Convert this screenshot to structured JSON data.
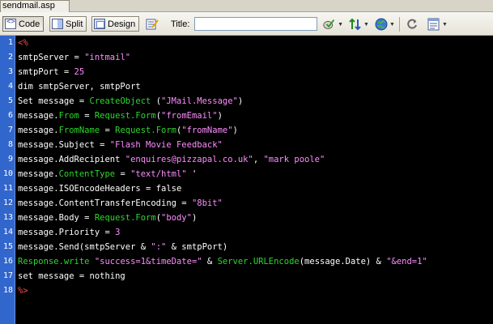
{
  "tab": {
    "label": "sendmail.asp"
  },
  "toolbar": {
    "code_label": "Code",
    "split_label": "Split",
    "design_label": "Design",
    "title_label": "Title:",
    "title_value": "",
    "icons": [
      "live-data-icon",
      "file-management-icon",
      "preview-globe-icon",
      "refresh-icon",
      "view-options-icon",
      "validate-icon"
    ]
  },
  "colors": {
    "background": "#000000",
    "gutter": "#3166cc",
    "plain": "#ffffff",
    "string": "#ff8cff",
    "member": "#2bd92b",
    "delimiter": "#ff4a4a"
  },
  "code_lines": [
    {
      "n": "1",
      "tokens": [
        [
          "delim",
          "<%"
        ]
      ]
    },
    {
      "n": "2",
      "tokens": [
        [
          "plain",
          "smtpServer = "
        ],
        [
          "string",
          "\"intmail\""
        ]
      ]
    },
    {
      "n": "3",
      "tokens": [
        [
          "plain",
          "smtpPort = "
        ],
        [
          "number",
          "25"
        ]
      ]
    },
    {
      "n": "4",
      "tokens": [
        [
          "plain",
          "dim smtpServer, smtpPort"
        ]
      ]
    },
    {
      "n": "5",
      "tokens": [
        [
          "plain",
          "Set message = "
        ],
        [
          "member",
          "CreateObject"
        ],
        [
          "plain",
          " ("
        ],
        [
          "string",
          "\"JMail.Message\""
        ],
        [
          "plain",
          ")"
        ]
      ]
    },
    {
      "n": "6",
      "tokens": [
        [
          "plain",
          "message."
        ],
        [
          "member",
          "From"
        ],
        [
          "plain",
          " = "
        ],
        [
          "member",
          "Request.Form"
        ],
        [
          "plain",
          "("
        ],
        [
          "string",
          "\"fromEmail\""
        ],
        [
          "plain",
          ")"
        ]
      ]
    },
    {
      "n": "7",
      "tokens": [
        [
          "plain",
          "message."
        ],
        [
          "member",
          "FromName"
        ],
        [
          "plain",
          " = "
        ],
        [
          "member",
          "Request.Form"
        ],
        [
          "plain",
          "("
        ],
        [
          "string",
          "\"fromName\""
        ],
        [
          "plain",
          ")"
        ]
      ]
    },
    {
      "n": "8",
      "tokens": [
        [
          "plain",
          "message.Subject = "
        ],
        [
          "string",
          "\"Flash Movie Feedback\""
        ]
      ]
    },
    {
      "n": "9",
      "tokens": [
        [
          "plain",
          "message.AddRecipient "
        ],
        [
          "string",
          "\"enquires@pizzapal.co.uk\""
        ],
        [
          "plain",
          ", "
        ],
        [
          "string",
          "\"mark poole\""
        ]
      ]
    },
    {
      "n": "10",
      "tokens": [
        [
          "plain",
          "message."
        ],
        [
          "member",
          "ContentType"
        ],
        [
          "plain",
          " = "
        ],
        [
          "string",
          "\"text/html\""
        ],
        [
          "plain",
          " '"
        ]
      ]
    },
    {
      "n": "11",
      "tokens": [
        [
          "plain",
          "message.ISOEncodeHeaders = false"
        ]
      ]
    },
    {
      "n": "12",
      "tokens": [
        [
          "plain",
          "message.ContentTransferEncoding = "
        ],
        [
          "string",
          "\"8bit\""
        ]
      ]
    },
    {
      "n": "13",
      "tokens": [
        [
          "plain",
          "message.Body = "
        ],
        [
          "member",
          "Request.Form"
        ],
        [
          "plain",
          "("
        ],
        [
          "string",
          "\"body\""
        ],
        [
          "plain",
          ")"
        ]
      ]
    },
    {
      "n": "14",
      "tokens": [
        [
          "plain",
          "message.Priority = "
        ],
        [
          "number",
          "3"
        ]
      ]
    },
    {
      "n": "15",
      "tokens": [
        [
          "plain",
          "message.Send(smtpServer & "
        ],
        [
          "string",
          "\":\""
        ],
        [
          "plain",
          " & smtpPort)"
        ]
      ]
    },
    {
      "n": "16",
      "tokens": [
        [
          "member",
          "Response.write"
        ],
        [
          "plain",
          " "
        ],
        [
          "string",
          "\"success=1&timeDate=\""
        ],
        [
          "plain",
          " & "
        ],
        [
          "member",
          "Server.URLEncode"
        ],
        [
          "plain",
          "(message.Date) & "
        ],
        [
          "string",
          "\"&end=1\""
        ]
      ]
    },
    {
      "n": "17",
      "tokens": [
        [
          "plain",
          "set message = nothing"
        ]
      ]
    },
    {
      "n": "18",
      "tokens": [
        [
          "delim",
          "%>"
        ]
      ]
    }
  ]
}
